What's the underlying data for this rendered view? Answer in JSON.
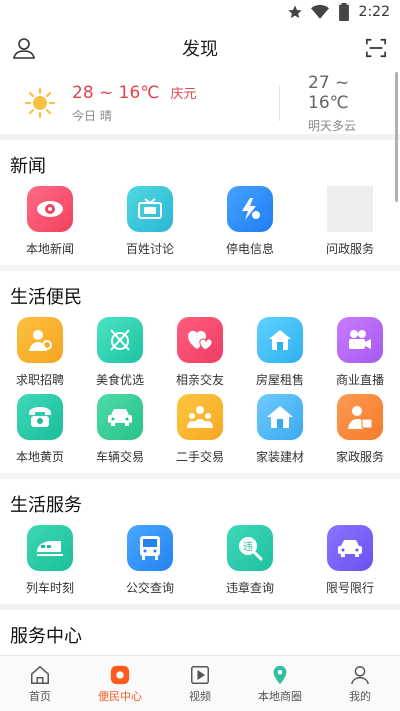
{
  "status": {
    "time": "2:22"
  },
  "header": {
    "title": "发现"
  },
  "weather": {
    "today_temp": "28 ~ 16℃",
    "today_city": "庆元",
    "today_label": "今日 晴",
    "tomorrow_temp": "27 ~ 16℃",
    "tomorrow_label": "明天多云"
  },
  "sections": {
    "news": {
      "title": "新闻",
      "items": [
        {
          "label": "本地新闻"
        },
        {
          "label": "百姓讨论"
        },
        {
          "label": "停电信息"
        },
        {
          "label": "问政服务"
        }
      ]
    },
    "life": {
      "title": "生活便民",
      "items": [
        {
          "label": "求职招聘"
        },
        {
          "label": "美食优选"
        },
        {
          "label": "相亲交友"
        },
        {
          "label": "房屋租售"
        },
        {
          "label": "商业直播"
        },
        {
          "label": "本地黄页"
        },
        {
          "label": "车辆交易"
        },
        {
          "label": "二手交易"
        },
        {
          "label": "家装建材"
        },
        {
          "label": "家政服务"
        }
      ]
    },
    "services": {
      "title": "生活服务",
      "items": [
        {
          "label": "列车时刻"
        },
        {
          "label": "公交查询"
        },
        {
          "label": "违章查询"
        },
        {
          "label": "限号限行"
        }
      ]
    },
    "center": {
      "title": "服务中心"
    }
  },
  "tabs": [
    {
      "label": "首页"
    },
    {
      "label": "便民中心"
    },
    {
      "label": "视频"
    },
    {
      "label": "本地商圈"
    },
    {
      "label": "我的"
    }
  ],
  "colors": {
    "accent": "#ff5a1f",
    "warm_temp": "#e0454e"
  }
}
